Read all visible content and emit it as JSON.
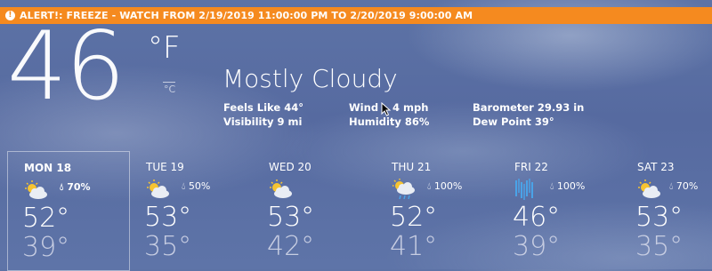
{
  "alert": {
    "icon": "alert-icon",
    "text": "ALERT!: FREEZE - WATCH FROM 2/19/2019 11:00:00 PM TO 2/20/2019 9:00:00 AM",
    "color": "#f58a1f"
  },
  "current": {
    "temperature": "46",
    "unit_f": "°F",
    "unit_c": "°C",
    "condition": "Mostly Cloudy",
    "feels_like": "Feels Like 44°",
    "visibility": "Visibility 9 mi",
    "wind": "Wind",
    "wind_value": "4 mph",
    "humidity": "Humidity 86%",
    "barometer": "Barometer 29.93 in",
    "dew_point": "Dew Point 39°"
  },
  "forecast": [
    {
      "day": "MON 18",
      "icon": "partly-cloudy-icon",
      "precip": "70%",
      "high": "52°",
      "low": "39°",
      "selected": true
    },
    {
      "day": "TUE 19",
      "icon": "partly-cloudy-icon",
      "precip": "50%",
      "high": "53°",
      "low": "35°"
    },
    {
      "day": "WED 20",
      "icon": "partly-cloudy-icon",
      "precip": "",
      "high": "53°",
      "low": "42°"
    },
    {
      "day": "THU 21",
      "icon": "showers-icon",
      "precip": "100%",
      "high": "52°",
      "low": "41°"
    },
    {
      "day": "FRI 22",
      "icon": "rain-icon",
      "precip": "100%",
      "high": "46°",
      "low": "39°"
    },
    {
      "day": "SAT 23",
      "icon": "partly-cloudy-icon",
      "precip": "70%",
      "high": "53°",
      "low": "35°"
    }
  ]
}
